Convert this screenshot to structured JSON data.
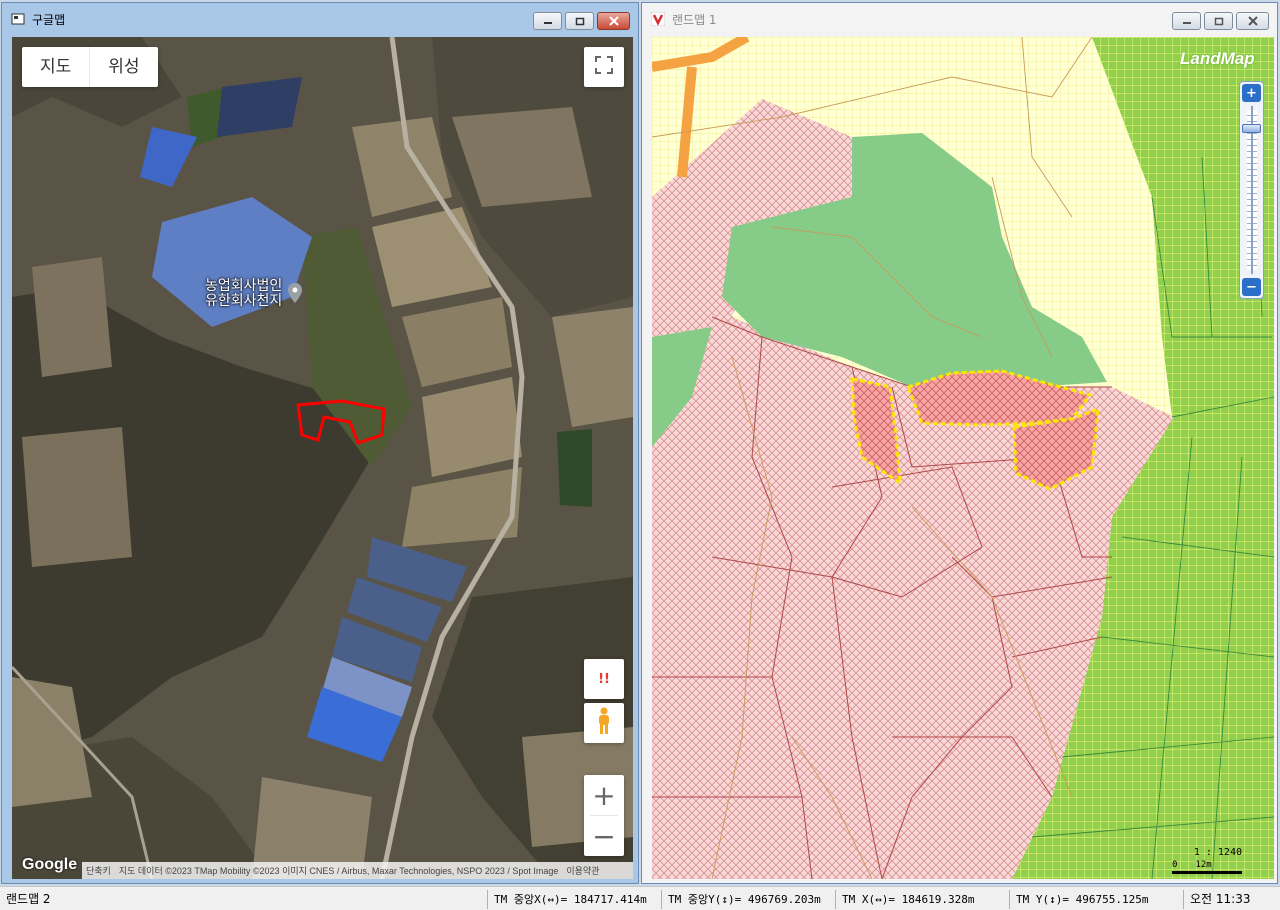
{
  "left_window": {
    "title": "구글맵",
    "map_type_tabs": [
      "지도",
      "위성"
    ],
    "place_label_line1": "농업회사법인",
    "place_label_line2": "유한회사천지",
    "google_logo": "Google",
    "attribution": {
      "shortcuts": "단축키",
      "map_data": "지도 데이터 ©2023 TMap Mobility ©2023 이미지 CNES / Airbus, Maxar Technologies, NSPO 2023 / Spot Image",
      "terms": "이용약관"
    },
    "zoom_in": "+",
    "zoom_out": "−",
    "alert_icon": "!!"
  },
  "right_window": {
    "title": "랜드맵 1",
    "logo": "LandMap",
    "zoom_plus": "+",
    "zoom_minus": "−",
    "scale_ratio": "1 : 1240",
    "scale_zero": "0",
    "scale_distance": "12m"
  },
  "statusbar": {
    "app_name": "랜드맵 2",
    "tm_center_x": "TM 중앙X(↔)= 184717.414m",
    "tm_center_y": "TM 중앙Y(↕)= 496769.203m",
    "tm_x": "TM X(↔)= 184619.328m",
    "tm_y": "TM Y(↕)= 496755.125m",
    "clock": "오전 11:33"
  },
  "colors": {
    "titlebar_active": "#a9c7e6",
    "close_button": "#c84b36",
    "landmap_green_grid": "#8fd14f",
    "landmap_yellow_grid": "#ffffb0",
    "landmap_forest": "#86cc88",
    "landmap_red_hatch": "#f2c6c6",
    "selection_outline": "#ffe600",
    "parcel_outline_red": "#ff0000"
  }
}
